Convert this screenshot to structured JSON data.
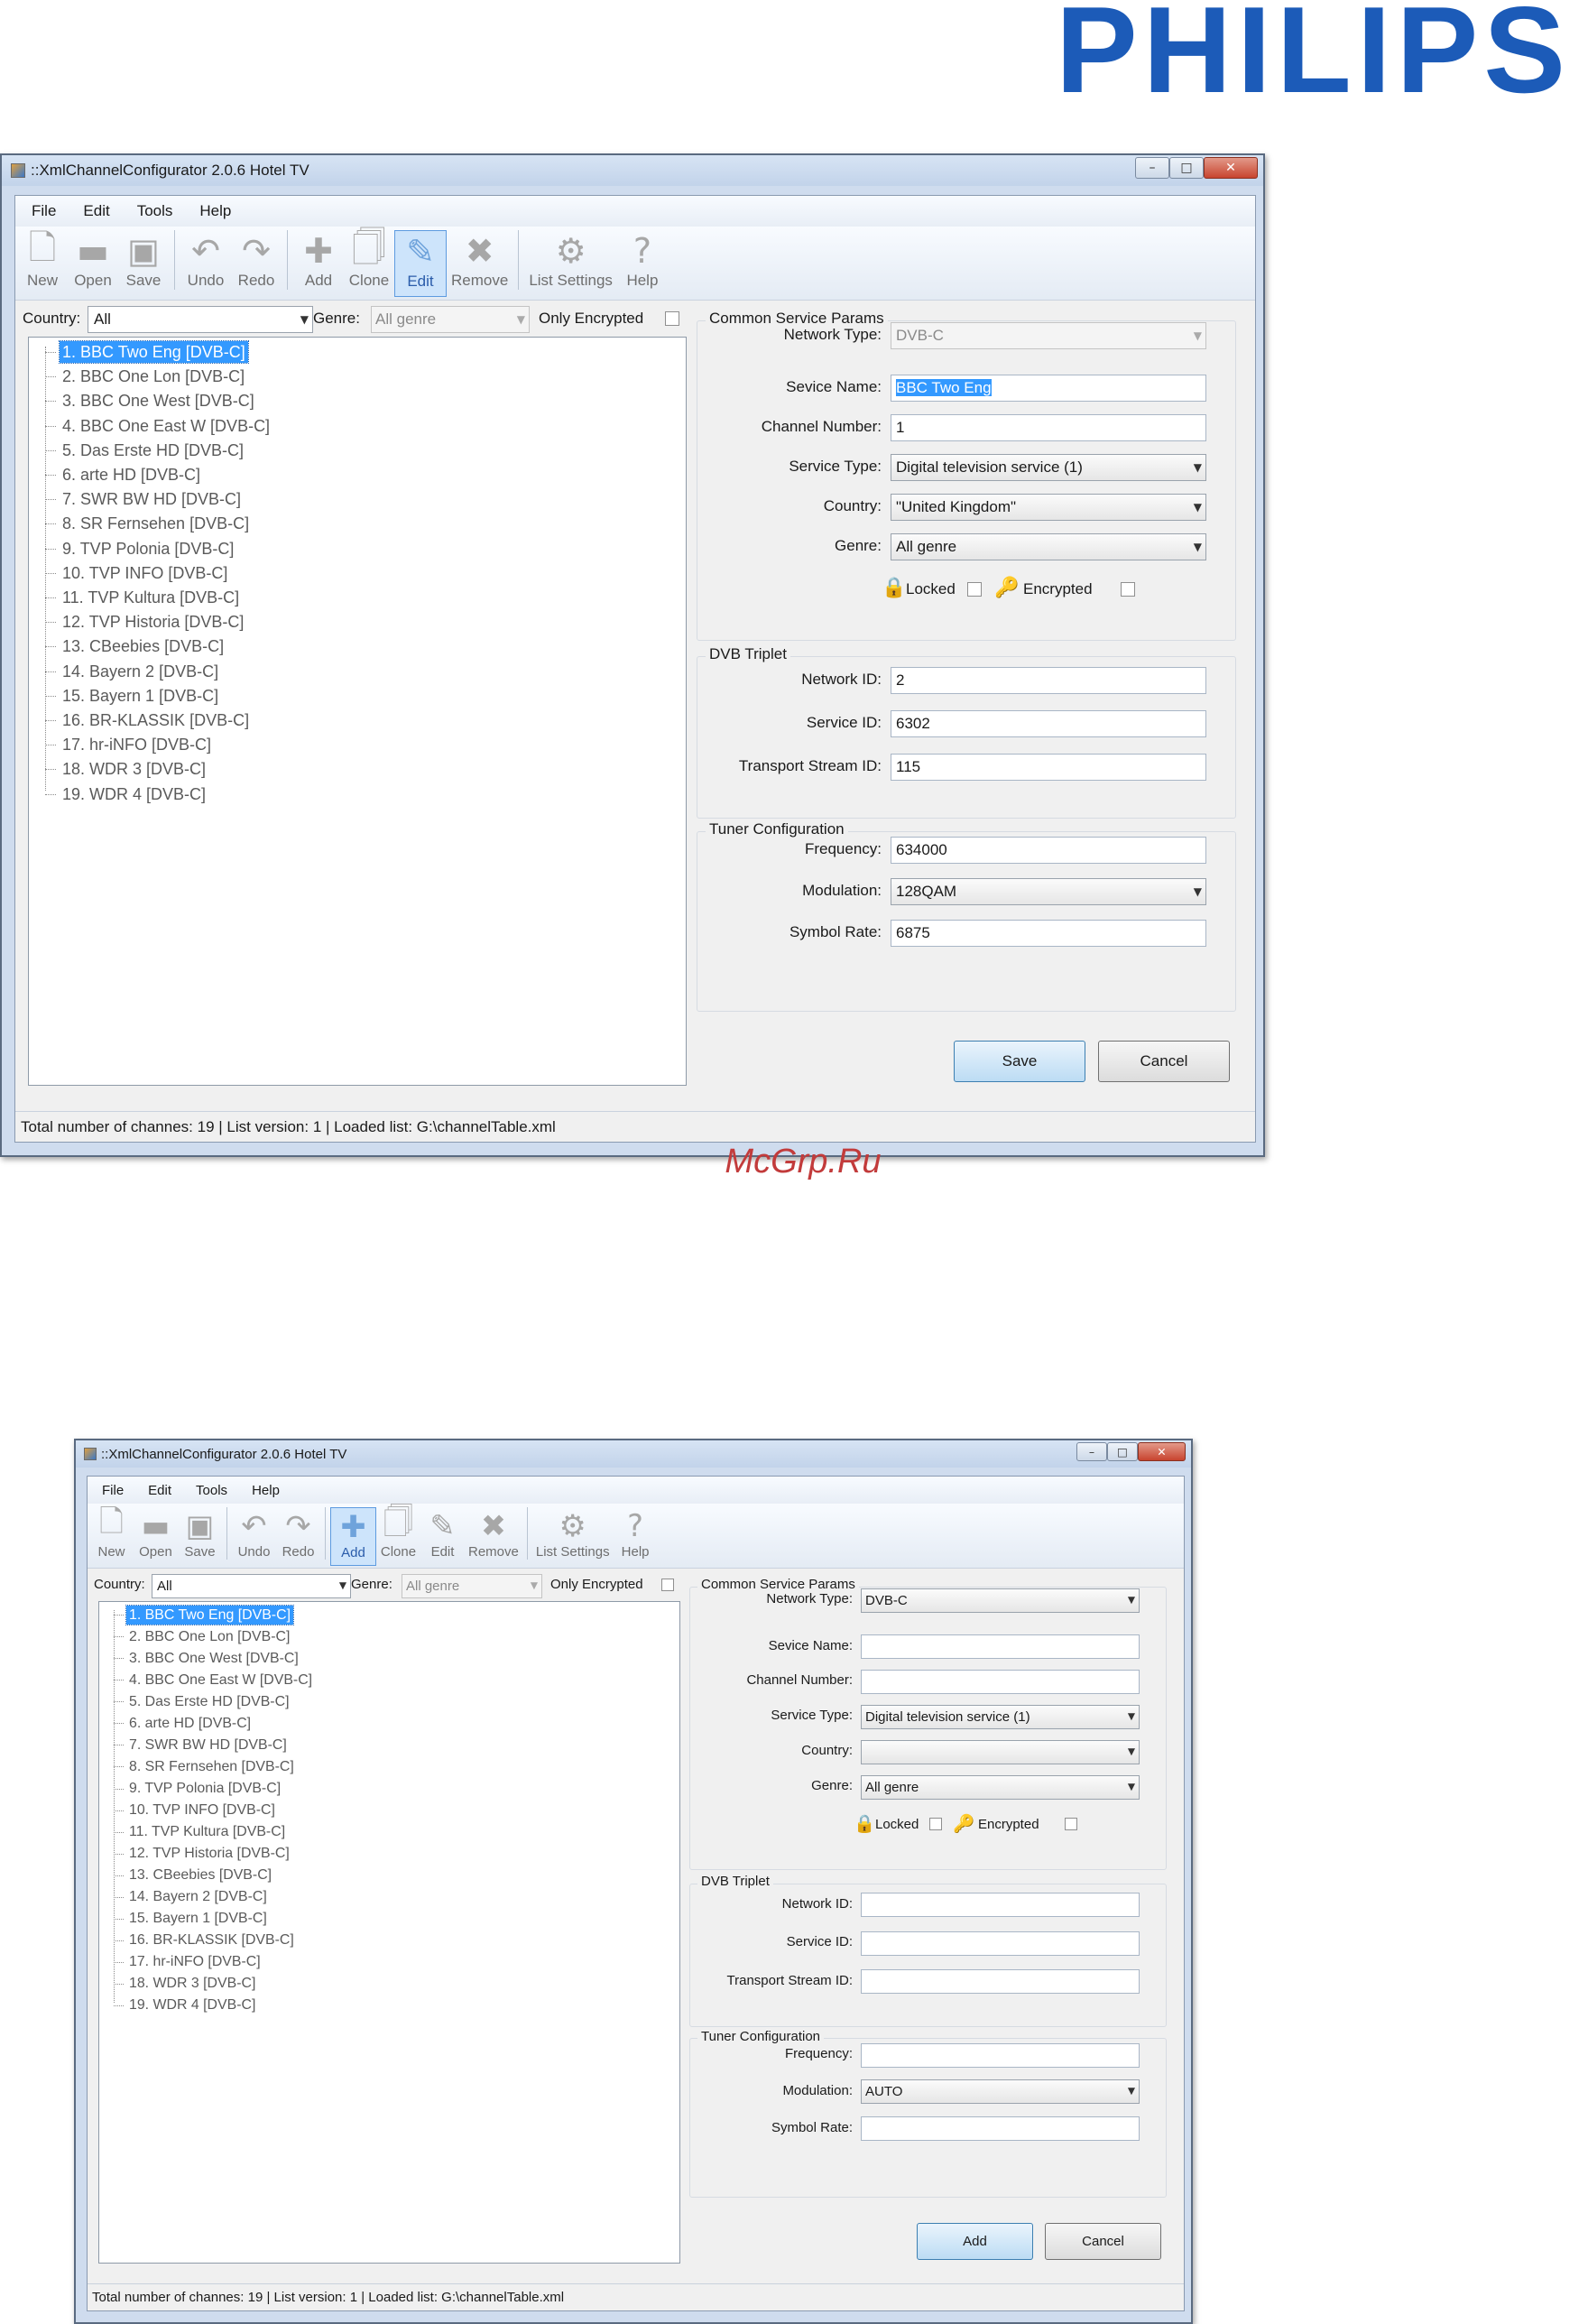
{
  "brand": {
    "logo_text": "PHILIPS"
  },
  "watermark": "McGrp.Ru",
  "toolbar_labels": {
    "new": "New",
    "open": "Open",
    "save": "Save",
    "undo": "Undo",
    "redo": "Redo",
    "add": "Add",
    "clone": "Clone",
    "edit": "Edit",
    "remove": "Remove",
    "list_settings": "List Settings",
    "help": "Help"
  },
  "menu": {
    "file": "File",
    "edit": "Edit",
    "tools": "Tools",
    "help": "Help"
  },
  "filters": {
    "country_label": "Country:",
    "country_value": "All",
    "genre_label": "Genre:",
    "genre_value": "All genre",
    "only_encrypted_label": "Only Encrypted"
  },
  "labels": {
    "common_params": "Common Service Params",
    "network_type": "Network Type:",
    "service_name": "Sevice Name:",
    "channel_number": "Channel Number:",
    "service_type": "Service Type:",
    "country": "Country:",
    "genre": "Genre:",
    "locked": "Locked",
    "encrypted": "Encrypted",
    "dvb_triplet": "DVB Triplet",
    "network_id": "Network ID:",
    "service_id": "Service ID:",
    "transport_stream_id": "Transport Stream ID:",
    "tuner_config": "Tuner Configuration",
    "frequency": "Frequency:",
    "modulation": "Modulation:",
    "symbol_rate": "Symbol Rate:",
    "cancel": "Cancel"
  },
  "channels": [
    "1. BBC Two Eng [DVB-C]",
    "2. BBC One Lon [DVB-C]",
    "3. BBC One West [DVB-C]",
    "4. BBC One East W [DVB-C]",
    "5. Das Erste HD [DVB-C]",
    "6. arte HD [DVB-C]",
    "7. SWR BW HD [DVB-C]",
    "8. SR Fernsehen [DVB-C]",
    "9. TVP Polonia [DVB-C]",
    "10. TVP INFO [DVB-C]",
    "11. TVP Kultura [DVB-C]",
    "12. TVP Historia [DVB-C]",
    "13. CBeebies [DVB-C]",
    "14. Bayern 2 [DVB-C]",
    "15. Bayern 1 [DVB-C]",
    "16. BR-KLASSIK [DVB-C]",
    "17. hr-iNFO [DVB-C]",
    "18. WDR 3 [DVB-C]",
    "19. WDR 4 [DVB-C]"
  ],
  "windows": {
    "edit": {
      "title": "::XmlChannelConfigurator 2.0.6 Hotel TV",
      "active_tool": "edit",
      "form": {
        "network_type": "DVB-C",
        "service_name": "BBC Two Eng",
        "channel_number": "1",
        "service_type": "Digital television service (1)",
        "country": "\"United Kingdom\"",
        "genre": "All genre",
        "network_id": "2",
        "service_id": "6302",
        "transport_stream_id": "115",
        "frequency": "634000",
        "modulation": "128QAM",
        "symbol_rate": "6875"
      },
      "primary_button": "Save",
      "status": "Total number of channes:  19  |  List version:  1  |  Loaded list:  G:\\channelTable.xml"
    },
    "add": {
      "title": "::XmlChannelConfigurator 2.0.6 Hotel TV",
      "active_tool": "add",
      "form": {
        "network_type": "DVB-C",
        "service_name": "",
        "channel_number": "",
        "service_type": "Digital television service (1)",
        "country": "",
        "genre": "All genre",
        "network_id": "",
        "service_id": "",
        "transport_stream_id": "",
        "frequency": "",
        "modulation": "AUTO",
        "symbol_rate": ""
      },
      "primary_button": "Add",
      "status": "Total number of channes:  19  |  List version:  1  |  Loaded list:  G:\\channelTable.xml"
    }
  }
}
